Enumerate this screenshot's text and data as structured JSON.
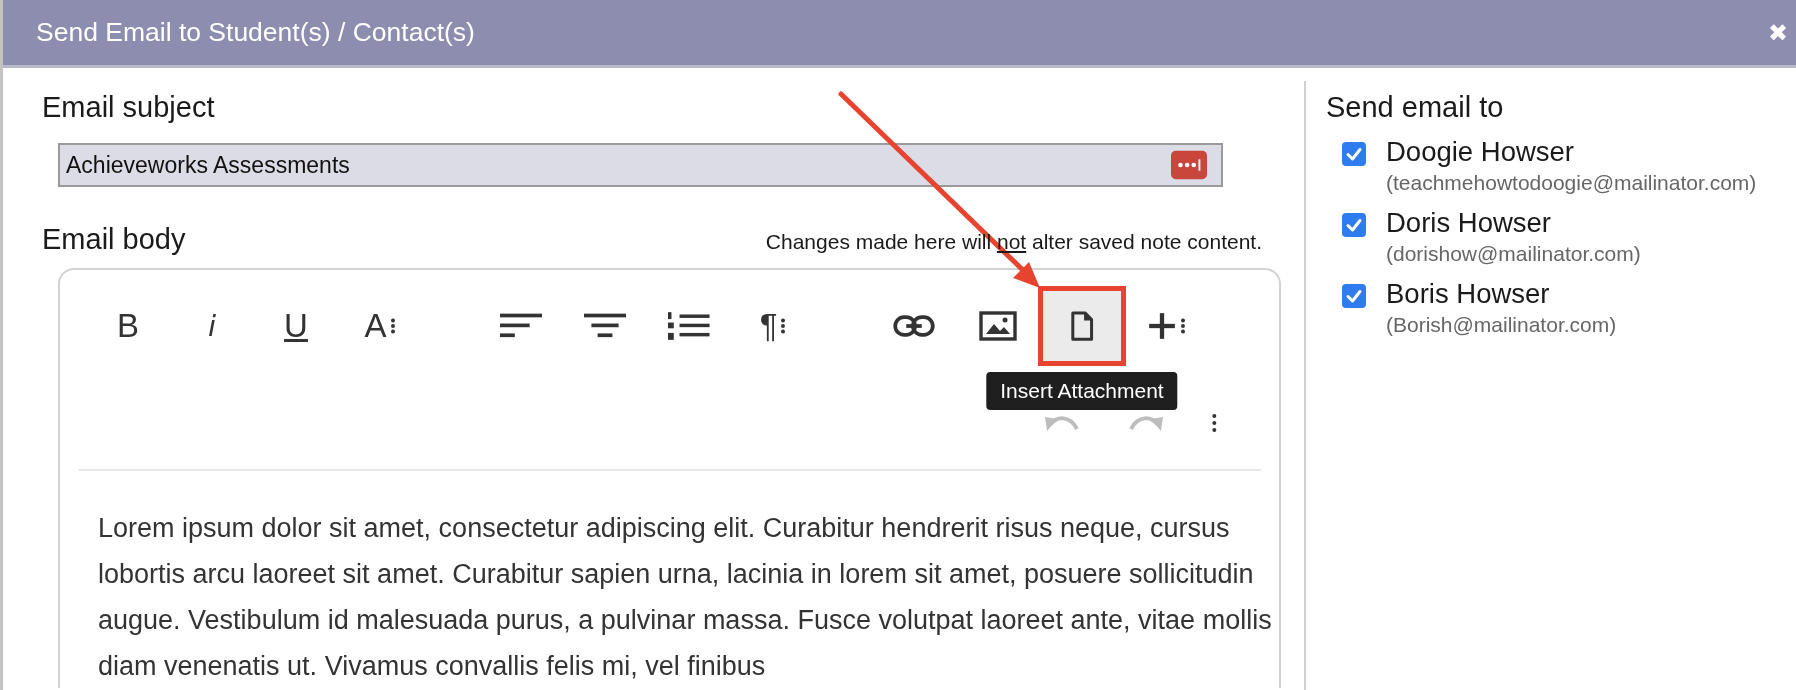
{
  "window": {
    "title": "Send Email to Student(s) / Contact(s)",
    "close": "✖"
  },
  "subject": {
    "label": "Email subject",
    "value": "Achieveworks Assessments"
  },
  "body": {
    "label": "Email body",
    "note": "Changes made here will **not** alter saved note content.",
    "toolbar": [
      {
        "kind": "text",
        "label": "B",
        "highlighted": false
      },
      {
        "kind": "text",
        "label": "i",
        "highlighted": false
      },
      {
        "kind": "text",
        "label": "U",
        "highlighted": false
      },
      {
        "kind": "text-menu",
        "label": "A",
        "highlighted": false
      },
      {
        "kind": "align-left",
        "highlighted": false
      },
      {
        "kind": "align-center",
        "highlighted": false
      },
      {
        "kind": "ordered-list",
        "highlighted": false
      },
      {
        "kind": "text-menu",
        "label": "¶",
        "highlighted": false
      },
      {
        "kind": "link",
        "highlighted": false
      },
      {
        "kind": "image",
        "highlighted": false
      },
      {
        "kind": "file",
        "highlighted": true,
        "tooltip": "Insert Attachment"
      },
      {
        "kind": "plus-menu",
        "highlighted": false
      }
    ],
    "toolbar_row2": [
      {
        "kind": "undo",
        "disabled": true
      },
      {
        "kind": "redo",
        "disabled": true
      },
      {
        "kind": "more",
        "disabled": false
      }
    ],
    "text": "Lorem ipsum dolor sit amet, consectetur adipiscing elit. Curabitur hendrerit risus neque, cursus lobortis arcu laoreet sit amet. Curabitur sapien urna, lacinia in lorem sit amet, posuere sollicitudin augue. Vestibulum id malesuada purus, a pulvinar massa. Fusce volutpat laoreet ante, vitae mollis diam venenatis ut. Vivamus convallis felis mi, vel finibus"
  },
  "recipients": {
    "label": "Send email to",
    "items": [
      {
        "name": "Doogie Howser",
        "email": "(teachmehowtodoogie@mailinator.com)",
        "checked": true
      },
      {
        "name": "Doris Howser",
        "email": "(dorishow@mailinator.com)",
        "checked": true
      },
      {
        "name": "Boris Howser",
        "email": "(Borish@mailinator.com)",
        "checked": true
      }
    ]
  },
  "annotation": {
    "arrow": true
  }
}
